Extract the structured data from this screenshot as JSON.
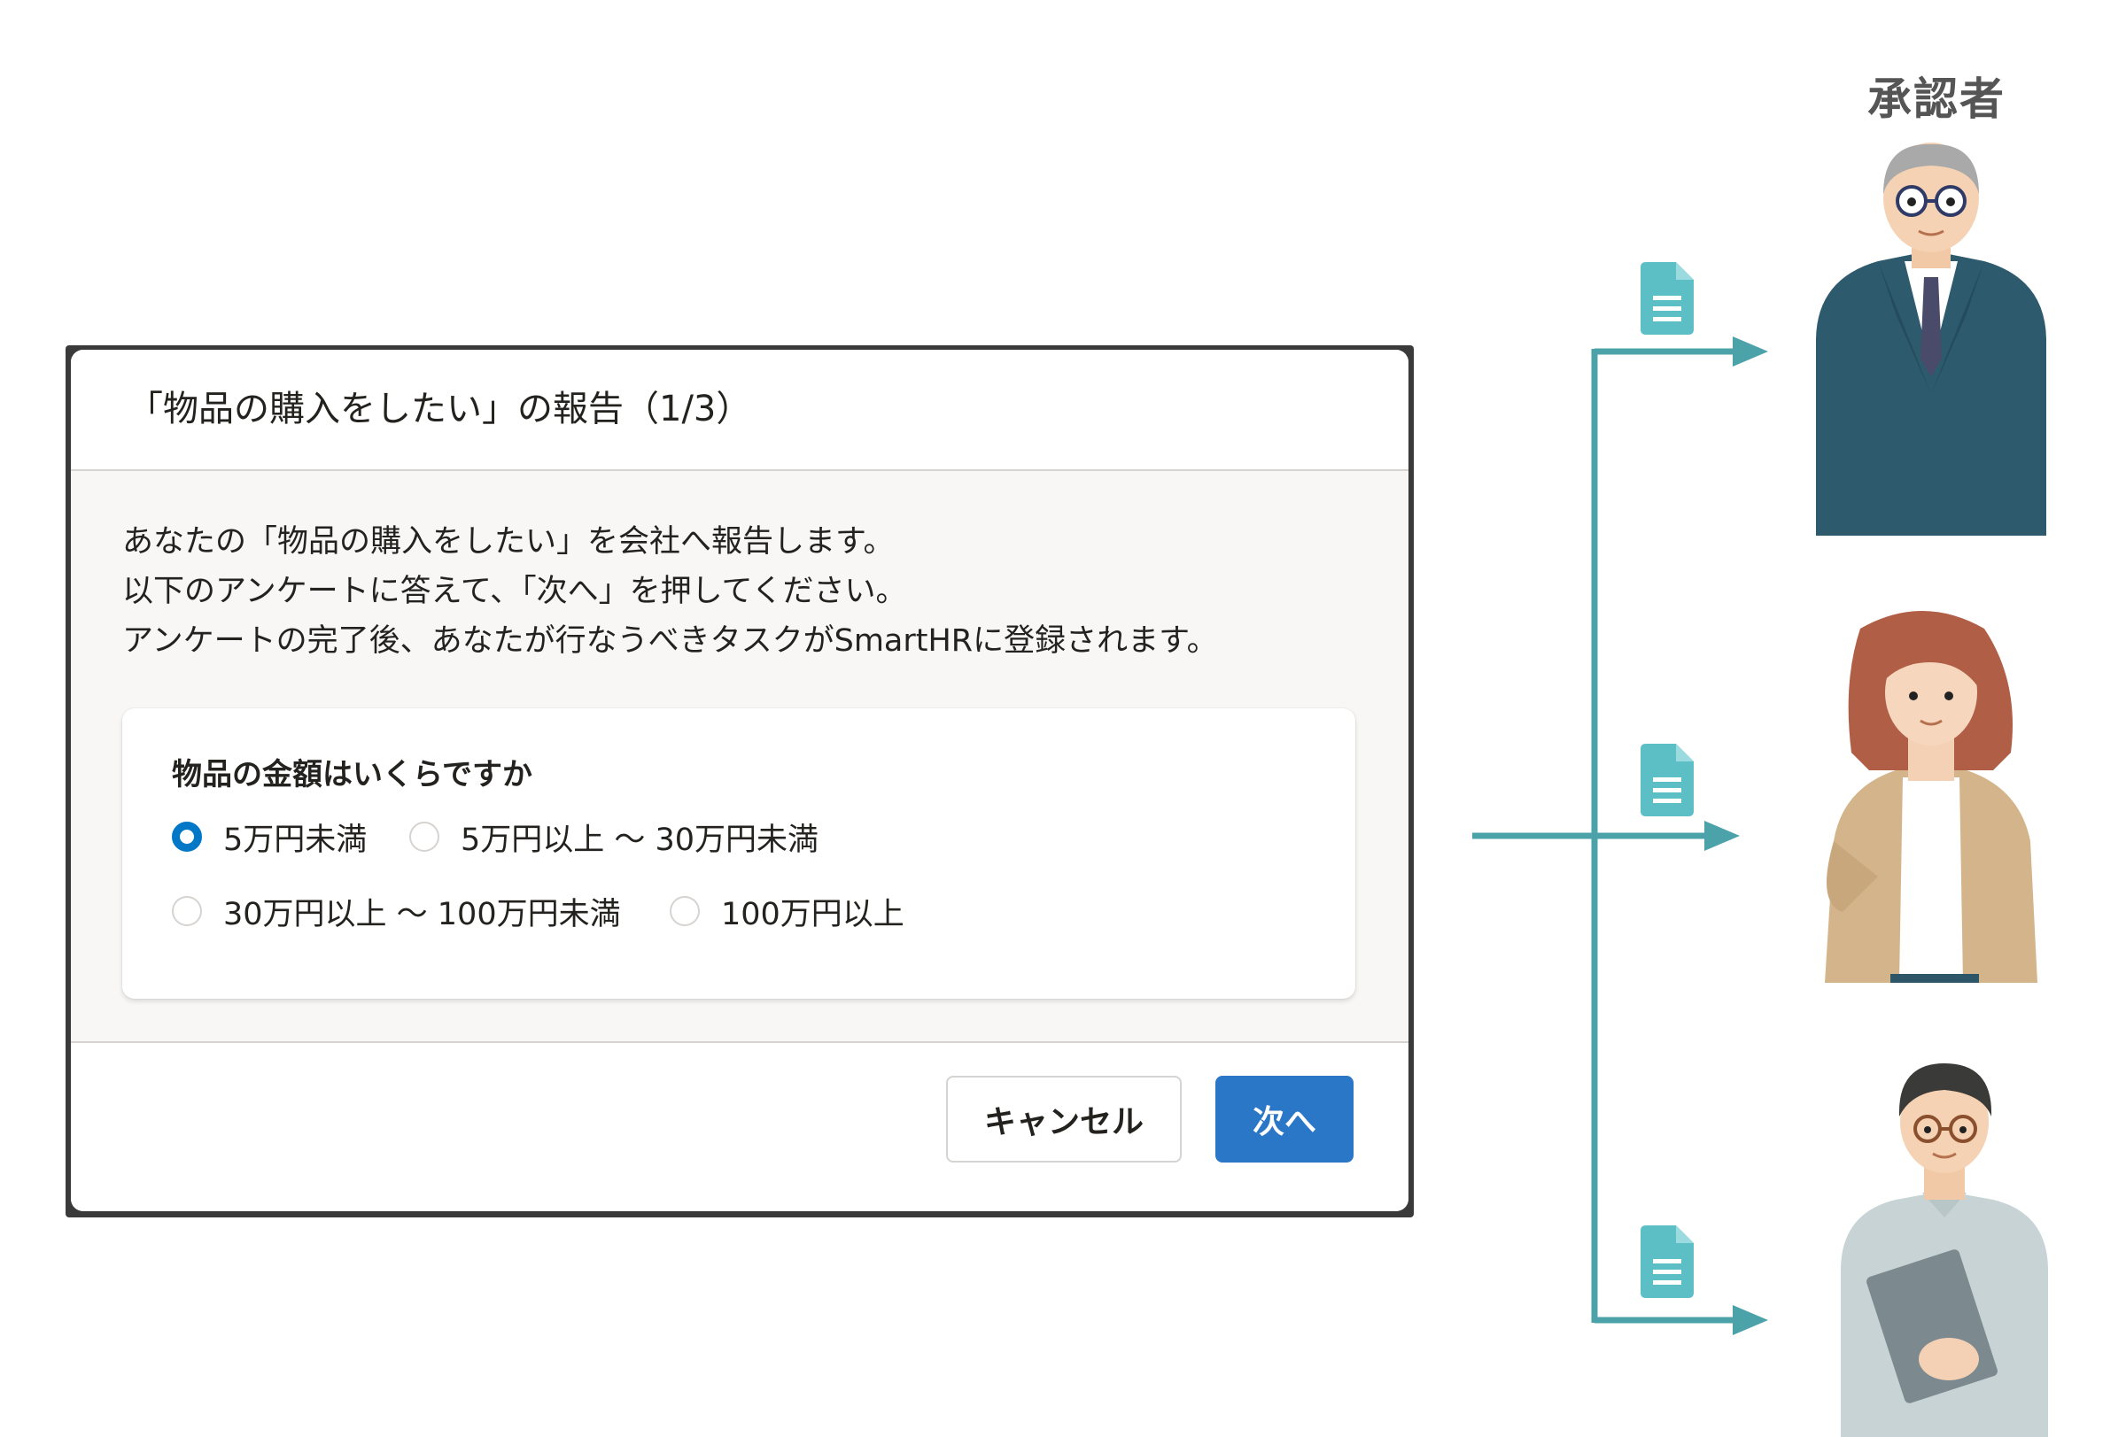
{
  "dialog": {
    "title": "「物品の購入をしたい」の報告（1/3）",
    "intro": [
      "あなたの「物品の購入をしたい」を会社へ報告します。",
      "以下のアンケートに答えて、「次へ」を押してください。",
      "アンケートの完了後、あなたが行なうべきタスクがSmartHRに登録されます。"
    ],
    "question": {
      "label": "物品の金額はいくらですか",
      "options": [
        {
          "label": "5万円未満",
          "selected": true
        },
        {
          "label": "5万円以上 〜 30万円未満",
          "selected": false
        },
        {
          "label": "30万円以上 〜 100万円未満",
          "selected": false
        },
        {
          "label": "100万円以上",
          "selected": false
        }
      ]
    },
    "buttons": {
      "cancel": "キャンセル",
      "next": "次へ"
    }
  },
  "diagram": {
    "approver_label": "承認者",
    "colors": {
      "flow": "#4ba3a9",
      "doc": "#5bbfc5",
      "primary": "#2a76c7",
      "radio": "#0077c7"
    },
    "icons": [
      "document-icon",
      "document-icon",
      "document-icon"
    ],
    "people": [
      "senior-approver",
      "female-approver",
      "male-approver"
    ]
  }
}
